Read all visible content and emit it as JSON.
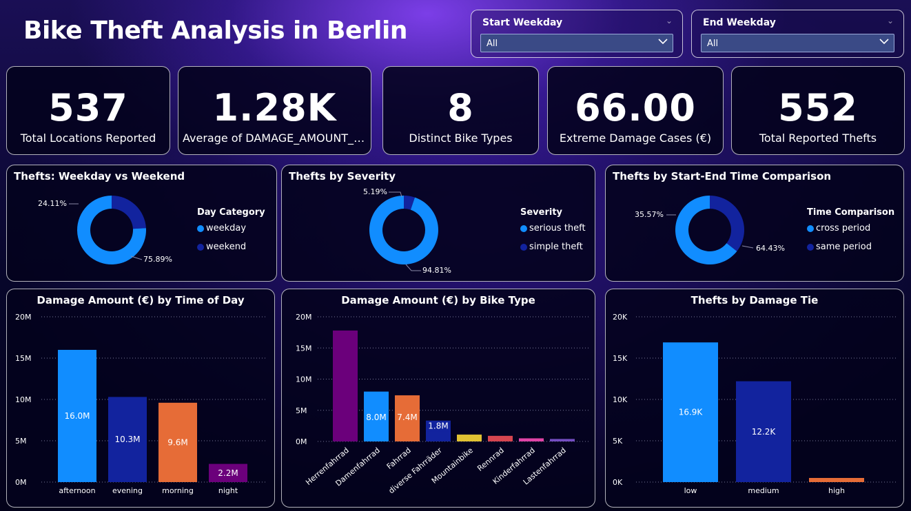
{
  "header": {
    "title": "Bike Theft Analysis in Berlin"
  },
  "slicers": [
    {
      "label": "Start Weekday",
      "value": "All"
    },
    {
      "label": "End Weekday",
      "value": "All"
    }
  ],
  "kpis": [
    {
      "value": "537",
      "label": "Total Locations Reported"
    },
    {
      "value": "1.28K",
      "label": "Average of DAMAGE_AMOUNT_E..."
    },
    {
      "value": "8",
      "label": "Distinct Bike Types"
    },
    {
      "value": "66.00",
      "label": "Extreme Damage Cases (€)"
    },
    {
      "value": "552",
      "label": "Total Reported Thefts"
    }
  ],
  "colors": {
    "blue": "#118dff",
    "navy": "#12239e",
    "orange": "#e66c37",
    "purple": "#6b007b",
    "yellow": "#e1c233",
    "red": "#d64550",
    "pink": "#e044a7",
    "violet": "#744ec2"
  },
  "donut1": {
    "title": "Thefts: Weekday vs Weekend",
    "legend_title": "Day Category",
    "chart_data": {
      "type": "pie",
      "labels": [
        "weekday",
        "weekend"
      ],
      "values": [
        75.89,
        24.11
      ],
      "data_labels": [
        "75.89%",
        "24.11%"
      ]
    }
  },
  "donut2": {
    "title": "Thefts by Severity",
    "legend_title": "Severity",
    "chart_data": {
      "type": "pie",
      "labels": [
        "serious theft",
        "simple theft"
      ],
      "values": [
        94.81,
        5.19
      ],
      "data_labels": [
        "94.81%",
        "5.19%"
      ]
    }
  },
  "donut3": {
    "title": "Thefts by Start-End Time Comparison",
    "legend_title": "Time Comparison",
    "chart_data": {
      "type": "pie",
      "labels": [
        "cross period",
        "same period"
      ],
      "values": [
        64.43,
        35.57
      ],
      "data_labels": [
        "64.43%",
        "35.57%"
      ]
    }
  },
  "bar1": {
    "title": "Damage Amount (€) by Time of Day",
    "chart_data": {
      "type": "bar",
      "categories": [
        "afternoon",
        "evening",
        "morning",
        "night"
      ],
      "values": [
        16.0,
        10.3,
        9.6,
        2.2
      ],
      "data_labels": [
        "16.0M",
        "10.3M",
        "9.6M",
        "2.2M"
      ],
      "yticks": [
        "0M",
        "5M",
        "10M",
        "15M",
        "20M"
      ],
      "ylim": [
        0,
        20
      ]
    }
  },
  "bar2": {
    "title": "Damage Amount (€) by Bike Type",
    "chart_data": {
      "type": "bar",
      "categories": [
        "Herrenfahrrad",
        "Damenfahrrad",
        "Fahrrad",
        "diverse Fahrräder",
        "Mountainbike",
        "Rennrad",
        "Kinderfahrrad",
        "Lastenfahrrad"
      ],
      "values": [
        17.8,
        8.0,
        7.4,
        1.8,
        1.1,
        0.9,
        0.5,
        0.4
      ],
      "data_labels": [
        "",
        "8.0M",
        "7.4M",
        "1.8M",
        "",
        "",
        "",
        ""
      ],
      "yticks": [
        "0M",
        "5M",
        "10M",
        "15M",
        "20M"
      ],
      "ylim": [
        0,
        20
      ]
    }
  },
  "bar3": {
    "title": "Thefts by Damage Tie",
    "chart_data": {
      "type": "bar",
      "categories": [
        "low",
        "medium",
        "high"
      ],
      "values": [
        16.9,
        12.2,
        0.5
      ],
      "data_labels": [
        "16.9K",
        "12.2K",
        ""
      ],
      "yticks": [
        "0K",
        "5K",
        "10K",
        "15K",
        "20K"
      ],
      "ylim": [
        0,
        20
      ]
    }
  }
}
